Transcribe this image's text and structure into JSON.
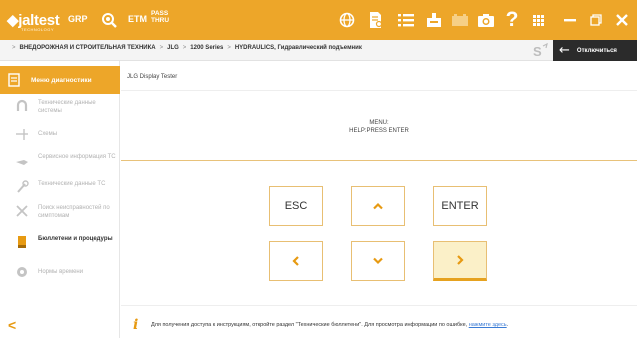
{
  "app": {
    "logo": "jaltest",
    "logo_sub": "TECHNOLOGY",
    "toolbar": {
      "grp_label": "GRP",
      "etm_label": "ETM",
      "pass_label_1": "PASS",
      "pass_label_2": "THRU",
      "help_label": "?"
    },
    "colors": {
      "accent": "#eda629",
      "dark": "#2b2b2b",
      "link": "#3a7bd5"
    }
  },
  "breadcrumb": {
    "items": [
      "ВНЕДОРОЖНАЯ И СТРОИТЕЛЬНАЯ ТЕХНИКА",
      "JLG",
      "1200 Series",
      "HYDRAULICS, Гидравлический подъемник"
    ]
  },
  "disconnect": {
    "label": "Отключиться"
  },
  "sidebar": {
    "header": "Меню диагностики",
    "items": [
      {
        "label": "Технические данные системы",
        "icon": "horseshoe-magnet-icon",
        "active": false
      },
      {
        "label": "Схемы",
        "icon": "branch-icon",
        "active": false
      },
      {
        "label": "Сервисное информация ТС",
        "icon": "oil-can-icon",
        "active": false
      },
      {
        "label": "Технические данные ТС",
        "icon": "wrench-icon",
        "active": false
      },
      {
        "label": "Поиск неисправностей по симптомам",
        "icon": "tools-icon",
        "active": false
      },
      {
        "label": "Бюллетени и процедуры",
        "icon": "bulletin-book-icon",
        "active": true
      },
      {
        "label": "Нормы времени",
        "icon": "gear-clock-icon",
        "active": false
      }
    ],
    "back_glyph": "<"
  },
  "tester": {
    "title": "JLG Display Tester",
    "screen_line1": "MENU:",
    "screen_line2": "HELP:PRESS ENTER",
    "keys": {
      "esc": "ESC",
      "up": "^",
      "enter": "ENTER",
      "left": "<",
      "down": "v",
      "right": ">"
    }
  },
  "info": {
    "text": "Для получения доступа к инструкциям, откройте раздел \"Технические бюллетени\". Для просмотра информации по ошибке, ",
    "link": "нажмите здесь",
    "suffix": "."
  }
}
